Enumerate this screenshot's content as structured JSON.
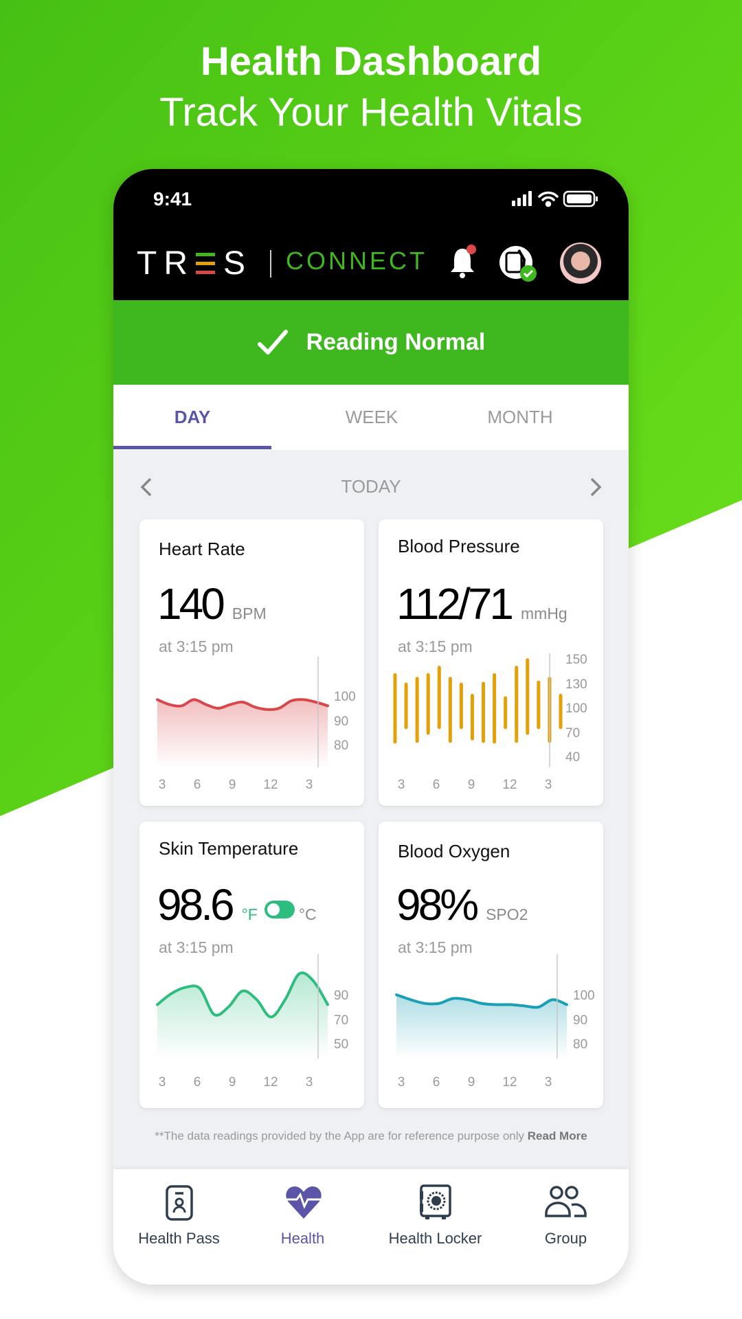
{
  "hero": {
    "title": "Health Dashboard",
    "subtitle": "Track Your Health Vitals"
  },
  "status_bar": {
    "time": "9:41",
    "icons": [
      "signal-icon",
      "wifi-icon",
      "battery-icon"
    ]
  },
  "header": {
    "brand_name": "TRES",
    "logo_parts": [
      "TR",
      "S"
    ],
    "connect": "CONNECT",
    "icons": [
      "bell-icon",
      "smartwatch-connected-icon",
      "avatar"
    ],
    "notification_dot": true
  },
  "banner": {
    "icon": "check-icon",
    "text": "Reading Normal"
  },
  "tabs": [
    {
      "label": "DAY",
      "active": true
    },
    {
      "label": "WEEK",
      "active": false
    },
    {
      "label": "MONTH",
      "active": false
    }
  ],
  "date_nav": {
    "label": "TODAY",
    "prev_icon": "chevron-left-icon",
    "next_icon": "chevron-right-icon"
  },
  "cards": [
    {
      "title": "Heart Rate",
      "value": "140",
      "unit": "BPM",
      "time": "at 3:15 pm"
    },
    {
      "title": "Blood Pressure",
      "value": "112/71",
      "unit": "mmHg",
      "time": "at 3:15 pm"
    },
    {
      "title": "Skin Temperature",
      "value": "98.6",
      "unit_f": "°F",
      "unit_c": "°C",
      "unit_toggle": "F",
      "time": "at 3:15 pm"
    },
    {
      "title": "Blood Oxygen",
      "value": "98%",
      "unit": "SPO2",
      "time": "at 3:15 pm"
    }
  ],
  "disclaimer": {
    "text": "**The data readings provided by the App are for reference purpose only ",
    "link": "Read More"
  },
  "bottom_nav": [
    {
      "label": "Health Pass",
      "icon": "id-badge-icon",
      "active": false
    },
    {
      "label": "Health",
      "icon": "heart-pulse-icon",
      "active": true
    },
    {
      "label": "Health Locker",
      "icon": "safe-icon",
      "active": false
    },
    {
      "label": "Group",
      "icon": "group-icon",
      "active": false
    }
  ],
  "colors": {
    "brand_green": "#3fb81f",
    "accent_purple": "#5b55a7",
    "heart": "#d9474b",
    "bp": "#e3a008",
    "temp": "#2dbd7e",
    "spo2": "#1a9fb5",
    "logo_e": [
      "#3fb81f",
      "#e3a008",
      "#d9474b"
    ]
  },
  "chart_data": [
    {
      "type": "area",
      "name": "Heart Rate",
      "x_ticks": [
        "3",
        "6",
        "9",
        "12",
        "3"
      ],
      "y_ticks": [
        100,
        90,
        80
      ],
      "values": [
        98.5,
        96.5,
        96,
        98.5,
        96.5,
        95,
        96.5,
        97.5,
        95.5,
        94.5,
        95,
        98,
        98.5,
        97.5,
        96
      ]
    },
    {
      "type": "range-bar",
      "name": "Blood Pressure",
      "x_ticks": [
        "3",
        "6",
        "9",
        "12",
        "3"
      ],
      "y_ticks": [
        150,
        130,
        100,
        70,
        40
      ],
      "ranges": [
        [
          137,
          58
        ],
        [
          129,
          76
        ],
        [
          134,
          59
        ],
        [
          137,
          69
        ],
        [
          143,
          76
        ],
        [
          134,
          59
        ],
        [
          129,
          76
        ],
        [
          115,
          62
        ],
        [
          130,
          59
        ],
        [
          137,
          58
        ],
        [
          112,
          76
        ],
        [
          143,
          59
        ],
        [
          149,
          69
        ],
        [
          131,
          76
        ],
        [
          134,
          59
        ],
        [
          115,
          76
        ]
      ]
    },
    {
      "type": "area",
      "name": "Skin Temperature",
      "x_ticks": [
        "3",
        "6",
        "9",
        "12",
        "3"
      ],
      "y_ticks": [
        90,
        70,
        50
      ],
      "values": [
        82,
        91,
        96,
        95,
        74,
        80,
        93,
        86,
        72,
        86,
        107,
        101,
        82
      ]
    },
    {
      "type": "area",
      "name": "Blood Oxygen",
      "x_ticks": [
        "3",
        "6",
        "9",
        "12",
        "3"
      ],
      "y_ticks": [
        100,
        90,
        80
      ],
      "values": [
        100,
        98,
        96.5,
        96.5,
        98.5,
        98,
        96.5,
        96,
        96,
        95.5,
        95,
        98,
        96
      ]
    }
  ]
}
